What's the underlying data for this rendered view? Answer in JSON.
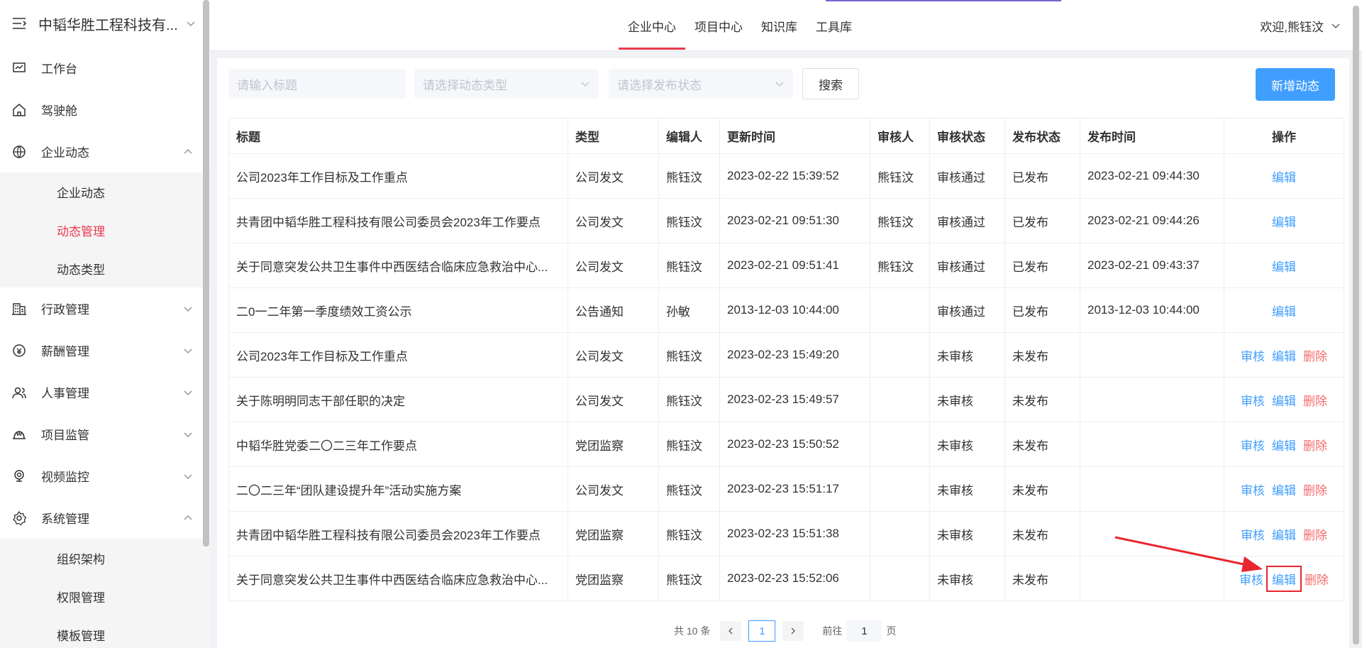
{
  "sidebar": {
    "brand": "中韬华胜工程科技有...",
    "items": [
      {
        "label": "工作台",
        "icon": "dashboard-icon",
        "expanded": null
      },
      {
        "label": "驾驶舱",
        "icon": "home-icon",
        "expanded": null
      },
      {
        "label": "企业动态",
        "icon": "globe-icon",
        "expanded": true,
        "children": [
          {
            "label": "企业动态",
            "active": false
          },
          {
            "label": "动态管理",
            "active": true
          },
          {
            "label": "动态类型",
            "active": false
          }
        ]
      },
      {
        "label": "行政管理",
        "icon": "building-icon",
        "expanded": false
      },
      {
        "label": "薪酬管理",
        "icon": "salary-icon",
        "expanded": false
      },
      {
        "label": "人事管理",
        "icon": "people-icon",
        "expanded": false
      },
      {
        "label": "项目监管",
        "icon": "helmet-icon",
        "expanded": false
      },
      {
        "label": "视频监控",
        "icon": "camera-icon",
        "expanded": false
      },
      {
        "label": "系统管理",
        "icon": "settings-icon",
        "expanded": true,
        "children": [
          {
            "label": "组织架构",
            "active": false
          },
          {
            "label": "权限管理",
            "active": false
          },
          {
            "label": "模板管理",
            "active": false
          }
        ]
      }
    ]
  },
  "topbar": {
    "tabs": [
      {
        "label": "企业中心",
        "active": true
      },
      {
        "label": "项目中心",
        "active": false
      },
      {
        "label": "知识库",
        "active": false
      },
      {
        "label": "工具库",
        "active": false
      }
    ],
    "user": "欢迎,熊钰汶"
  },
  "filters": {
    "title_placeholder": "请输入标题",
    "type_placeholder": "请选择动态类型",
    "status_placeholder": "请选择发布状态",
    "search_label": "搜索",
    "add_label": "新增动态"
  },
  "table": {
    "headers": [
      "标题",
      "类型",
      "编辑人",
      "更新时间",
      "审核人",
      "审核状态",
      "发布状态",
      "发布时间",
      "操作"
    ],
    "actions": {
      "review": "审核",
      "edit": "编辑",
      "delete": "删除"
    },
    "rows": [
      {
        "title": "公司2023年工作目标及工作重点",
        "type": "公司发文",
        "editor": "熊钰汶",
        "updated": "2023-02-22 15:39:52",
        "reviewer": "熊钰汶",
        "review_status": "审核通过",
        "publish_status": "已发布",
        "published": "2023-02-21 09:44:30",
        "ops": [
          "edit"
        ]
      },
      {
        "title": "共青团中韬华胜工程科技有限公司委员会2023年工作要点",
        "type": "公司发文",
        "editor": "熊钰汶",
        "updated": "2023-02-21 09:51:30",
        "reviewer": "熊钰汶",
        "review_status": "审核通过",
        "publish_status": "已发布",
        "published": "2023-02-21 09:44:26",
        "ops": [
          "edit"
        ]
      },
      {
        "title": "关于同意突发公共卫生事件中西医结合临床应急救治中心...",
        "type": "公司发文",
        "editor": "熊钰汶",
        "updated": "2023-02-21 09:51:41",
        "reviewer": "熊钰汶",
        "review_status": "审核通过",
        "publish_status": "已发布",
        "published": "2023-02-21 09:43:37",
        "ops": [
          "edit"
        ]
      },
      {
        "title": "二0一二年第一季度绩效工资公示",
        "type": "公告通知",
        "editor": "孙敏",
        "updated": "2013-12-03 10:44:00",
        "reviewer": "",
        "review_status": "审核通过",
        "publish_status": "已发布",
        "published": "2013-12-03 10:44:00",
        "ops": [
          "edit"
        ]
      },
      {
        "title": "公司2023年工作目标及工作重点",
        "type": "公司发文",
        "editor": "熊钰汶",
        "updated": "2023-02-23 15:49:20",
        "reviewer": "",
        "review_status": "未审核",
        "publish_status": "未发布",
        "published": "",
        "ops": [
          "review",
          "edit",
          "delete"
        ]
      },
      {
        "title": "关于陈明明同志干部任职的决定",
        "type": "公司发文",
        "editor": "熊钰汶",
        "updated": "2023-02-23 15:49:57",
        "reviewer": "",
        "review_status": "未审核",
        "publish_status": "未发布",
        "published": "",
        "ops": [
          "review",
          "edit",
          "delete"
        ]
      },
      {
        "title": "中韬华胜党委二〇二三年工作要点",
        "type": "党团监察",
        "editor": "熊钰汶",
        "updated": "2023-02-23 15:50:52",
        "reviewer": "",
        "review_status": "未审核",
        "publish_status": "未发布",
        "published": "",
        "ops": [
          "review",
          "edit",
          "delete"
        ]
      },
      {
        "title": "二〇二三年“团队建设提升年”活动实施方案",
        "type": "公司发文",
        "editor": "熊钰汶",
        "updated": "2023-02-23 15:51:17",
        "reviewer": "",
        "review_status": "未审核",
        "publish_status": "未发布",
        "published": "",
        "ops": [
          "review",
          "edit",
          "delete"
        ]
      },
      {
        "title": "共青团中韬华胜工程科技有限公司委员会2023年工作要点",
        "type": "党团监察",
        "editor": "熊钰汶",
        "updated": "2023-02-23 15:51:38",
        "reviewer": "",
        "review_status": "未审核",
        "publish_status": "未发布",
        "published": "",
        "ops": [
          "review",
          "edit",
          "delete"
        ]
      },
      {
        "title": "关于同意突发公共卫生事件中西医结合临床应急救治中心...",
        "type": "党团监察",
        "editor": "熊钰汶",
        "updated": "2023-02-23 15:52:06",
        "reviewer": "",
        "review_status": "未审核",
        "publish_status": "未发布",
        "published": "",
        "ops": [
          "review",
          "edit",
          "delete"
        ],
        "highlight_edit": true
      }
    ]
  },
  "pagination": {
    "total": "共 10 条",
    "current_page": "1",
    "goto_label": "前往",
    "goto_value": "1",
    "page_suffix": "页"
  },
  "colors": {
    "accent": "#e8384f",
    "link": "#409eff",
    "danger": "#f56c6c",
    "annotation": "#e8262e"
  }
}
